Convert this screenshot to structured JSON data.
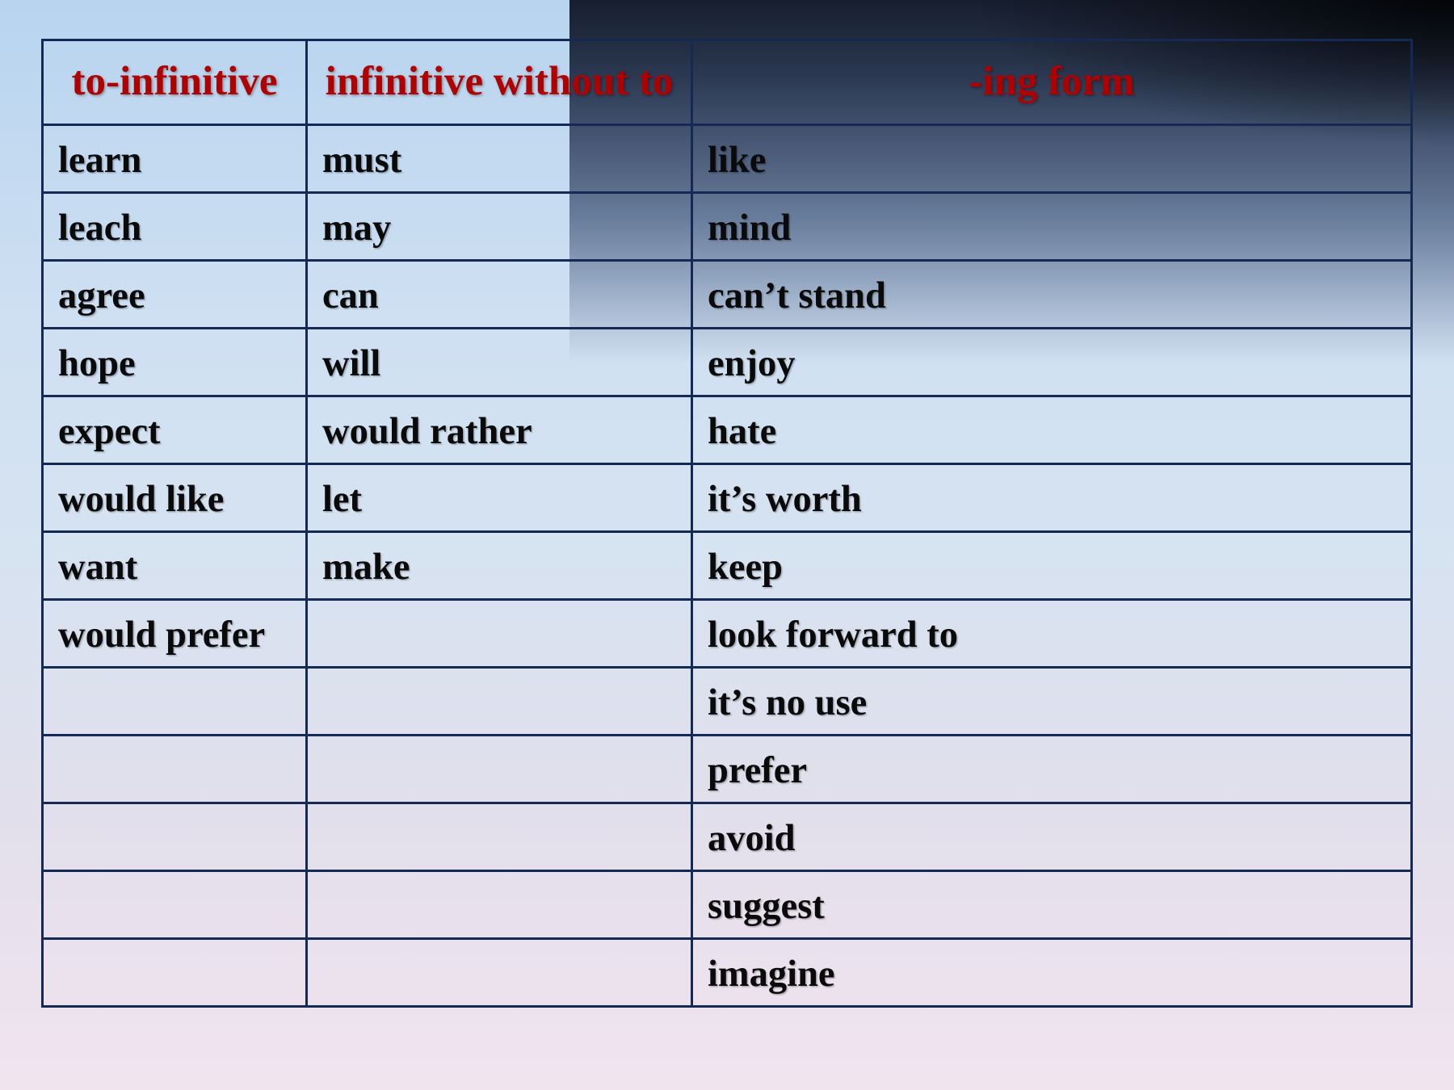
{
  "headers": [
    "to-infinitive",
    "infinitive without to",
    "-ing form"
  ],
  "rows": [
    [
      "learn",
      "must",
      "like"
    ],
    [
      "leach",
      "may",
      "mind"
    ],
    [
      "agree",
      "can",
      "can’t stand"
    ],
    [
      "hope",
      "will",
      "enjoy"
    ],
    [
      "expect",
      "would rather",
      "hate"
    ],
    [
      "would like",
      "let",
      "it’s worth"
    ],
    [
      "want",
      "make",
      "keep"
    ],
    [
      "would prefer",
      "",
      "look forward to"
    ],
    [
      "",
      "",
      "it’s no use"
    ],
    [
      "",
      "",
      "prefer"
    ],
    [
      "",
      "",
      "avoid"
    ],
    [
      "",
      "",
      "suggest"
    ],
    [
      "",
      "",
      "imagine"
    ]
  ]
}
